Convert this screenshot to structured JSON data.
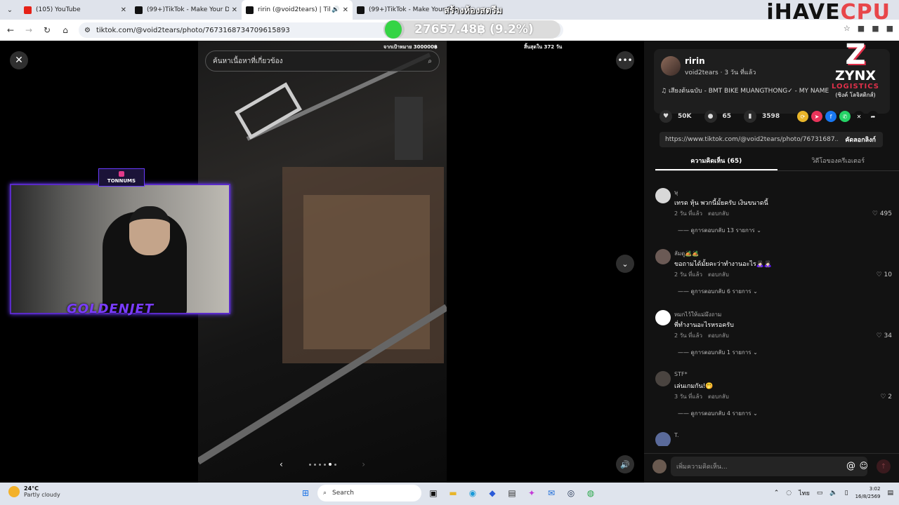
{
  "browser": {
    "tabs": [
      {
        "title": "(105) YouTube",
        "icon": "youtube-icon",
        "active": false
      },
      {
        "title": "(99+)TikTok - Make Your Day",
        "icon": "tiktok-icon",
        "active": false
      },
      {
        "title": "ririn (@void2tears) | TikTok",
        "icon": "tiktok-icon",
        "active": true
      },
      {
        "title": "(99+)TikTok - Make Your Day",
        "icon": "tiktok-icon",
        "active": false
      }
    ],
    "url": "tiktok.com/@void2tears/photo/7673168734709615893"
  },
  "overlay": {
    "create_room": "สร้างห้องสตรีม",
    "logo_left": "iHAVE",
    "logo_right": "CPU",
    "donate_amount": "27657.48฿ (9.2%)",
    "donate_progress": 0.092,
    "target": "จากเป้าหมาย 300000฿",
    "days_left": "สิ้นสุดใน 372 วัน",
    "cam_handle": "TONNUMS",
    "cam_label": "GOLDENJET",
    "sponsor_letter": "Z",
    "sponsor_brand": "ZYNX",
    "sponsor_sub": "LOGISTICS",
    "sponsor_th": "(ซิงค์ โลจิสติกส์)"
  },
  "viewer": {
    "search_placeholder": "ค้นหาเนื้อหาที่เกี่ยวข้อง",
    "slide_count": 6,
    "slide_current": 5
  },
  "post": {
    "author_name": "ririn",
    "author_meta": "void2tears · 3 วัน ที่แล้ว",
    "music": "เสียงต้นฉบับ - BMT BIKE MUANGTHONG✓ - MY NAME",
    "likes": "50K",
    "comments": "65",
    "saves": "3598",
    "link": "https://www.tiktok.com/@void2tears/photo/76731687...",
    "copy_label": "คัดลอกลิงก์"
  },
  "panel_tabs": [
    "ความคิดเห็น (65)",
    "วิดีโอของครีเอเตอร์"
  ],
  "comments": [
    {
      "user": "ษุ",
      "text": "เทรด หุ้น พวกนี้มั้ยครับ เงินขนาดนี้",
      "time": "2 วัน ที่แล้ว",
      "reply": "ตอบกลับ",
      "likes": "495",
      "more": "ดูการตอบกลับ 13 รายการ",
      "avatar": "#d8d8d8"
    },
    {
      "user": "ลัมดู🏕️🏕️",
      "text": "ขอถามได้มั้ยคะว่าทำงานอะไร🙇🏻‍♀️🙇🏻‍♀️",
      "time": "2 วัน ที่แล้ว",
      "reply": "ตอบกลับ",
      "likes": "10",
      "more": "ดูการตอบกลับ 6 รายการ",
      "avatar": "#6b5a55"
    },
    {
      "user": "หมกไว้ให้แม่มึงถาม",
      "text": "พี่ทำงานอะไรหรอครับ",
      "time": "2 วัน ที่แล้ว",
      "reply": "ตอบกลับ",
      "likes": "34",
      "more": "ดูการตอบกลับ 1 รายการ",
      "avatar": "#ffffff"
    },
    {
      "user": "STF*",
      "text": "เล่นเกมกัน!🤭",
      "time": "3 วัน ที่แล้ว",
      "reply": "ตอบกลับ",
      "likes": "2",
      "more": "ดูการตอบกลับ 4 รายการ",
      "avatar": "#4a4440"
    },
    {
      "user": "T.",
      "text": "",
      "time": "",
      "reply": "",
      "likes": "",
      "more": "",
      "avatar": "#5a6a9a"
    }
  ],
  "comment_placeholder": "เพิ่มความคิดเห็น...",
  "taskbar": {
    "temp": "24°C",
    "weather": "Partly cloudy",
    "search": "Search",
    "lang": "ไทย",
    "time": "3:02",
    "date": "16/8/2569"
  },
  "colors": {
    "accent_purple": "#6a3cff",
    "donate_green": "#35d445",
    "brand_red": "#e0304a"
  }
}
